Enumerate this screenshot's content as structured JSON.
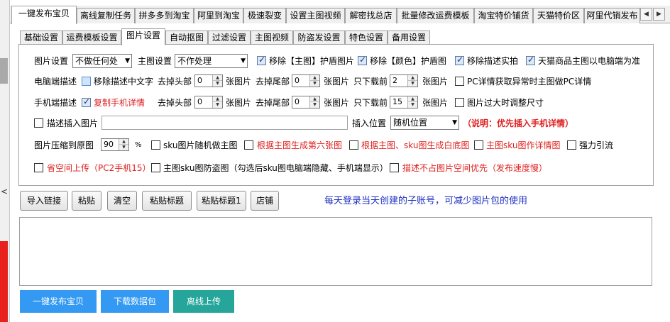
{
  "top_tabs": [
    {
      "label": "一键发布宝贝",
      "active": true
    },
    {
      "label": "离线复制任务"
    },
    {
      "label": "拼多多到淘宝"
    },
    {
      "label": "阿里到淘宝"
    },
    {
      "label": "极速裂变"
    },
    {
      "label": "设置主图视频"
    },
    {
      "label": "解密找总店"
    },
    {
      "label": "批量修改运费模板"
    },
    {
      "label": "淘宝特价铺货"
    },
    {
      "label": "天猫特价区"
    },
    {
      "label": "阿里代销发布"
    }
  ],
  "scroll_left": "◀",
  "scroll_right": "▶",
  "left_arrow": "<",
  "inner_tabs": [
    {
      "label": "基础设置"
    },
    {
      "label": "运费模板设置"
    },
    {
      "label": "图片设置",
      "active": true
    },
    {
      "label": "自动抠图"
    },
    {
      "label": "过滤设置"
    },
    {
      "label": "主图视频"
    },
    {
      "label": "防盗发设置"
    },
    {
      "label": "特色设置"
    },
    {
      "label": "备用设置"
    }
  ],
  "row1": {
    "image_setting_label": "图片设置",
    "image_setting_value": "不做任何处",
    "main_image_label": "主图设置",
    "main_image_value": "不作处理",
    "remove_main_shield": "移除【主图】护盾图片",
    "remove_color_shield": "移除【颜色】护盾图",
    "remove_desc_photo": "移除描述实拍",
    "tmall_main_pc": "天猫商品主图以电脑端为准"
  },
  "row2": {
    "pc_desc_label": "电脑端描述",
    "remove_desc_text": "移除描述中文字",
    "remove_head_label": "去掉头部",
    "remove_head_value": "0",
    "unit1": "张图片",
    "remove_tail_label": "去掉尾部",
    "remove_tail_value": "0",
    "unit2": "张图片",
    "download_first_label": "只下载前",
    "download_first_value": "2",
    "unit3": "张图片",
    "pc_detail_fallback": "PC详情获取异常时主图做PC详情"
  },
  "row3": {
    "mobile_desc_label": "手机端描述",
    "copy_mobile_detail": "复制手机详情",
    "remove_head_label": "去掉头部",
    "remove_head_value": "0",
    "unit1": "张图片",
    "remove_tail_label": "去掉尾部",
    "remove_tail_value": "0",
    "unit2": "张图片",
    "download_first_label": "只下载前",
    "download_first_value": "15",
    "unit3": "张图片",
    "resize_oversize": "图片过大时调整尺寸"
  },
  "row4": {
    "desc_insert_image": "描述插入图片",
    "insert_position_label": "插入位置",
    "insert_position_value": "随机位置",
    "note": "（说明：优先插入手机详情）"
  },
  "row5": {
    "compress_label": "图片压缩到原图",
    "compress_value": "90",
    "percent": "%",
    "sku_random_main": "sku图片随机做主图",
    "gen_sixth_main": "根据主图生成第六张图",
    "gen_white_bg": "根据主图、sku图生成白底图",
    "main_sku_detail": "主图sku图作详情图",
    "strong_traffic": "强力引流"
  },
  "row6": {
    "save_space": "省空间上传（PC2手机15）",
    "anti_theft": "主图sku图防盗图（勾选后sku图电脑端隐藏、手机端显示）",
    "desc_no_space": "描述不占图片空间优先（发布速度慢）"
  },
  "action_buttons": {
    "import_link": "导入链接",
    "paste": "粘贴",
    "clear": "清空",
    "paste_title": "粘贴标题",
    "paste_title1": "粘贴标题1",
    "shop": "店铺"
  },
  "tip_text": "每天登录当天创建的子账号，可减少图片包的使用",
  "bottom_buttons": {
    "publish": "一键发布宝贝",
    "download": "下载数据包",
    "offline_upload": "离线上传"
  },
  "colors": {
    "publish_btn": "#3399f3",
    "download_btn": "#3399f3",
    "offline_btn": "#26a69a",
    "red_text": "#e02020",
    "blue_text": "#1c2fc0"
  }
}
